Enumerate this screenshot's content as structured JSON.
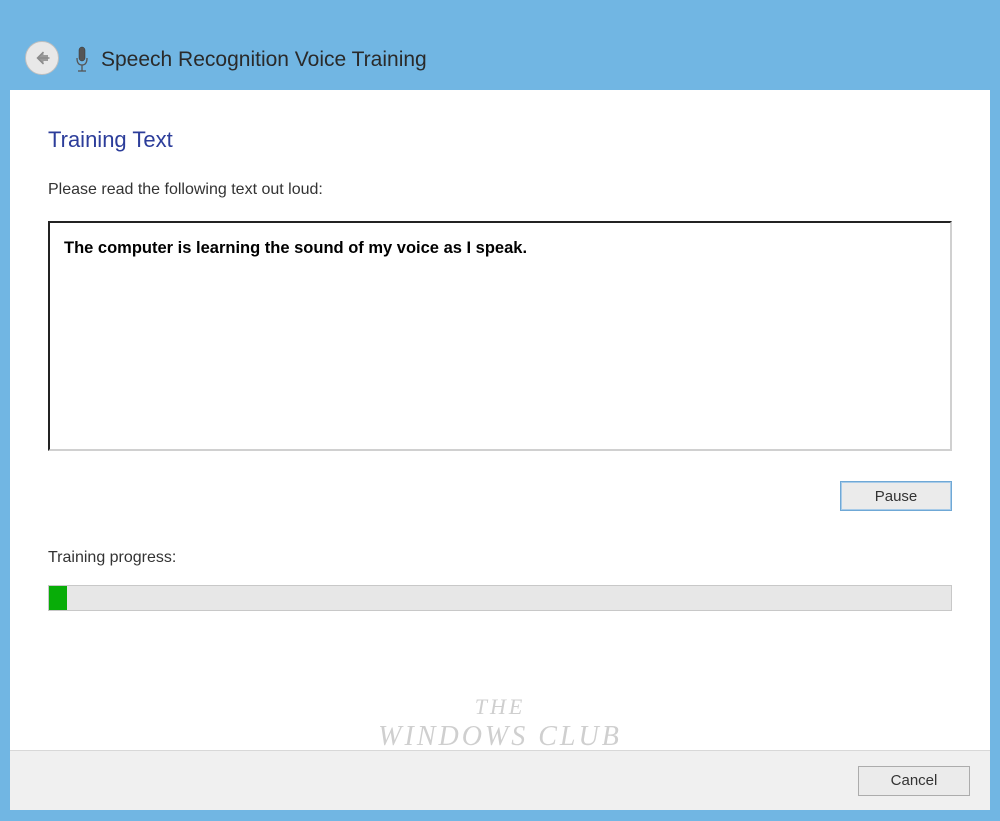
{
  "window": {
    "title": "Speech Recognition Voice Training"
  },
  "page": {
    "heading": "Training Text",
    "instruction": "Please read the following text out loud:",
    "training_sentence": "The computer is learning the sound of my voice as I speak.",
    "progress_label": "Training progress:",
    "progress_percent": 2
  },
  "buttons": {
    "pause": "Pause",
    "cancel": "Cancel"
  },
  "watermark": {
    "line1": "THE",
    "line2": "WINDOWS CLUB"
  }
}
